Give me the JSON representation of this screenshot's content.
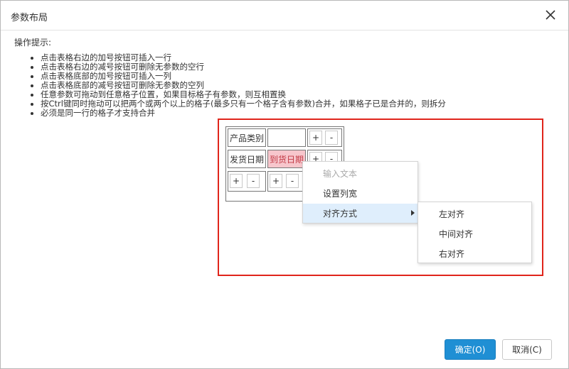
{
  "dialog": {
    "title": "参数布局",
    "close_icon": "close-icon"
  },
  "hint": {
    "title": "操作提示:",
    "items": [
      "点击表格右边的加号按钮可插入一行",
      "点击表格右边的减号按钮可删除无参数的空行",
      "点击表格底部的加号按钮可插入一列",
      "点击表格底部的减号按钮可删除无参数的空列",
      "任意参数可拖动到任意格子位置，如果目标格子有参数，则互相置换",
      "按Ctrl键同时拖动可以把两个或两个以上的格子(最多只有一个格子含有参数)合并，如果格子已是合并的，则拆分",
      "必须是同一行的格子才支持合并"
    ]
  },
  "grid": {
    "cells": {
      "r0c0": "产品类别",
      "r0c1": "",
      "r1c0": "发货日期",
      "r1c1": "到货日期"
    },
    "plus": "+",
    "minus": "-"
  },
  "context_menu": {
    "items": [
      "输入文本",
      "设置列宽",
      "对齐方式"
    ],
    "submenu": [
      "左对齐",
      "中间对齐",
      "右对齐"
    ]
  },
  "buttons": {
    "ok": "确定(O)",
    "cancel": "取消(C)"
  },
  "colors": {
    "primary": "#1f8fd4",
    "highlight_frame": "#e0251b",
    "selected_cell_bg": "#f7c6cc",
    "menu_active_bg": "#dfeefc"
  }
}
